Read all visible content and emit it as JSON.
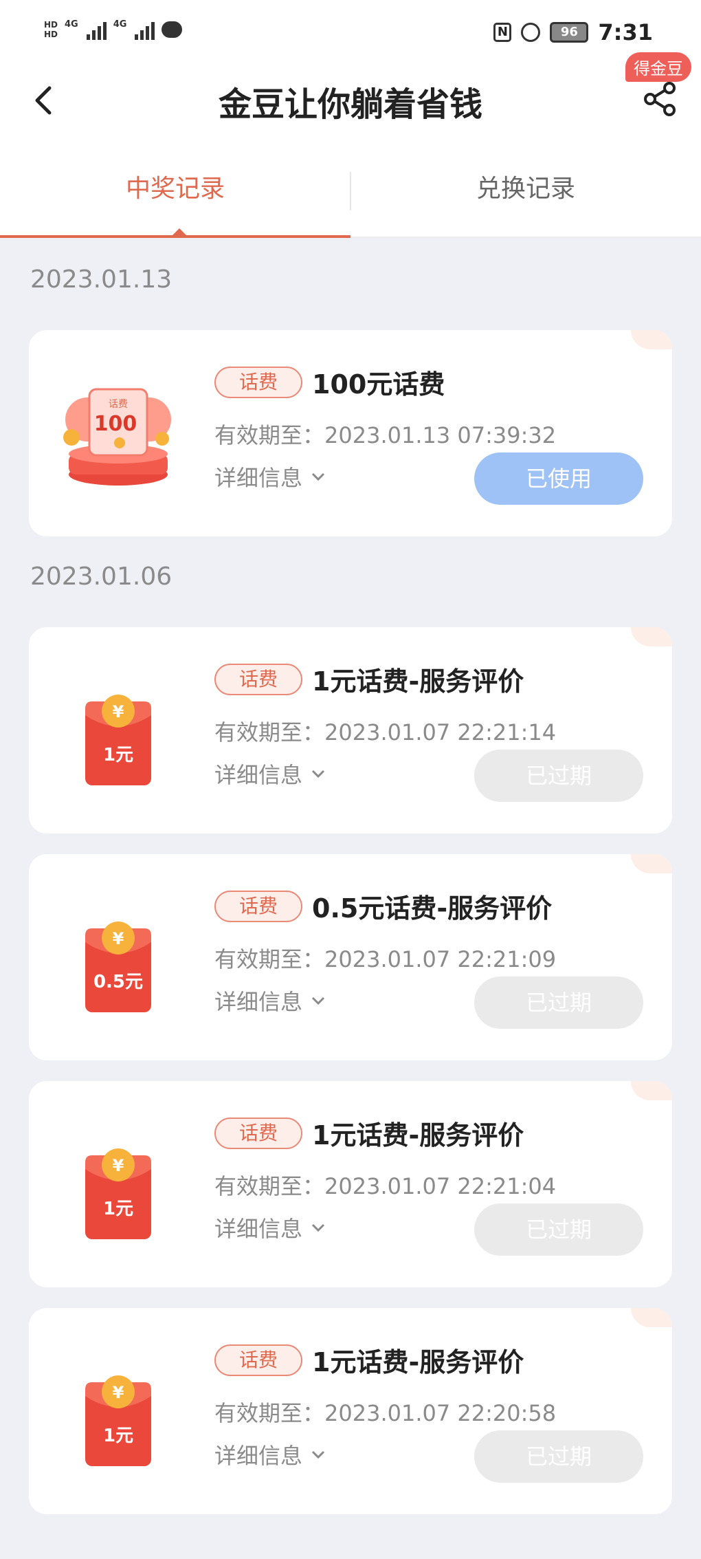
{
  "status_bar": {
    "hd_top": "HD",
    "hd_bottom": "HD",
    "net1": "4G",
    "net2": "4G",
    "battery": "96",
    "time": "7:31"
  },
  "header": {
    "title": "金豆让你躺着省钱",
    "coin_badge": "得金豆"
  },
  "tabs": [
    {
      "label": "中奖记录",
      "active": true
    },
    {
      "label": "兑换记录",
      "active": false
    }
  ],
  "colors": {
    "accent": "#e0684c",
    "used_button": "#9ec2f5",
    "expired_button": "#eaeaea",
    "page_bg": "#eef0f5"
  },
  "groups": [
    {
      "date": "2023.01.13"
    },
    {
      "date": "2023.01.06"
    }
  ],
  "records": [
    {
      "tag": "话费",
      "name": "100元话费",
      "validity": "有效期至：2023.01.13 07:39:32",
      "detail": "详细信息",
      "status": "已使用",
      "thumb_icon": "gift-box-100-icon",
      "thumb_label": "100",
      "thumb_caption": "话费"
    },
    {
      "tag": "话费",
      "name": "1元话费-服务评价",
      "validity": "有效期至：2023.01.07 22:21:14",
      "detail": "详细信息",
      "status": "已过期",
      "thumb_icon": "red-envelope-icon",
      "thumb_label": "1元"
    },
    {
      "tag": "话费",
      "name": "0.5元话费-服务评价",
      "validity": "有效期至：2023.01.07 22:21:09",
      "detail": "详细信息",
      "status": "已过期",
      "thumb_icon": "red-envelope-icon",
      "thumb_label": "0.5元"
    },
    {
      "tag": "话费",
      "name": "1元话费-服务评价",
      "validity": "有效期至：2023.01.07 22:21:04",
      "detail": "详细信息",
      "status": "已过期",
      "thumb_icon": "red-envelope-icon",
      "thumb_label": "1元"
    },
    {
      "tag": "话费",
      "name": "1元话费-服务评价",
      "validity": "有效期至：2023.01.07 22:20:58",
      "detail": "详细信息",
      "status": "已过期",
      "thumb_icon": "red-envelope-icon",
      "thumb_label": "1元"
    }
  ]
}
